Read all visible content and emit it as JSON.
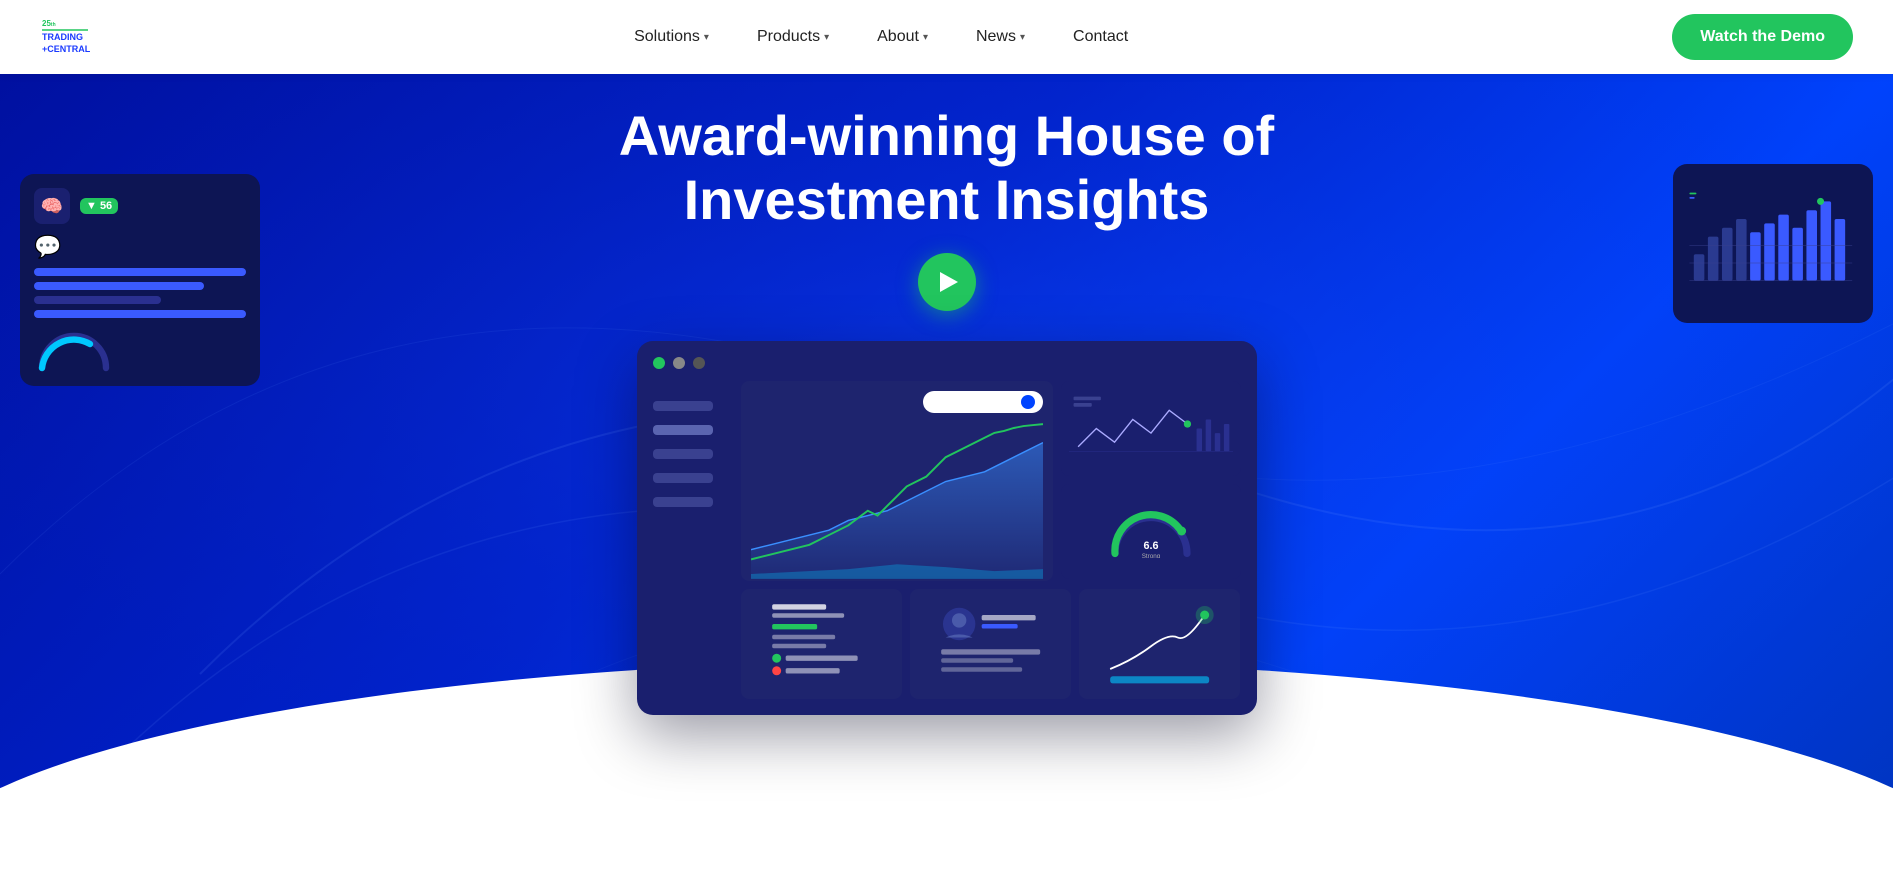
{
  "navbar": {
    "logo_text": "TRADING CENTRAL",
    "logo_anniversary": "25th",
    "nav_items": [
      {
        "label": "Solutions",
        "has_dropdown": true
      },
      {
        "label": "Products",
        "has_dropdown": true
      },
      {
        "label": "About",
        "has_dropdown": true
      },
      {
        "label": "News",
        "has_dropdown": true
      },
      {
        "label": "Contact",
        "has_dropdown": false
      }
    ],
    "cta_label": "Watch the Demo"
  },
  "hero": {
    "title_line1": "Award-winning House of",
    "title_line2": "Investment Insights",
    "play_button_label": "Play video"
  },
  "dashboard": {
    "titlebar_dots": [
      "green",
      "grey",
      "dark"
    ],
    "sidebar_items": 5,
    "search_placeholder": "...",
    "gauge_value": "6.6",
    "gauge_label": "Strong"
  },
  "left_widget": {
    "badge_label": "▼ 56",
    "icon": "🧠"
  },
  "icons": {
    "play": "▶",
    "chevron_down": "▾",
    "search": "🔍"
  }
}
